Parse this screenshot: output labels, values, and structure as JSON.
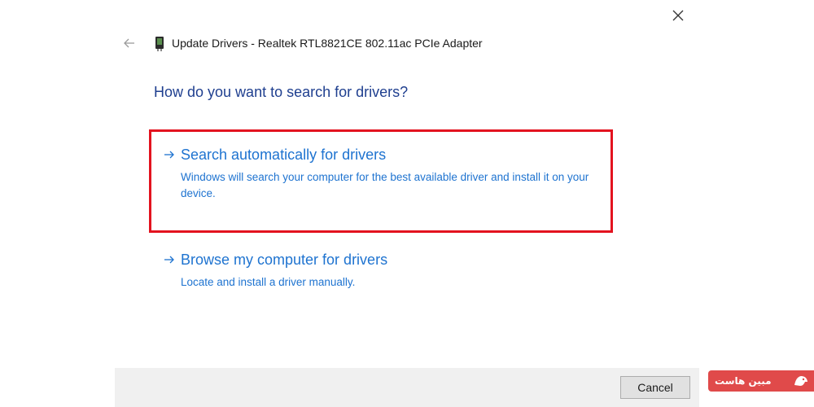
{
  "window": {
    "title": "Update Drivers - Realtek RTL8821CE 802.11ac PCIe Adapter"
  },
  "heading": "How do you want to search for drivers?",
  "options": [
    {
      "title": "Search automatically for drivers",
      "description": "Windows will search your computer for the best available driver and install it on your device."
    },
    {
      "title": "Browse my computer for drivers",
      "description": "Locate and install a driver manually."
    }
  ],
  "footer": {
    "cancel_label": "Cancel"
  },
  "watermark": {
    "text": "مبین هاست"
  },
  "icons": {
    "back": "back-arrow-icon",
    "close": "close-icon",
    "device": "device-icon",
    "option_arrow": "right-arrow-icon"
  },
  "colors": {
    "heading": "#1f3f8f",
    "link": "#1e73d0",
    "highlight": "#e3131f",
    "footer_bg": "#f0f0f0",
    "watermark_bg": "#e04a4a"
  }
}
